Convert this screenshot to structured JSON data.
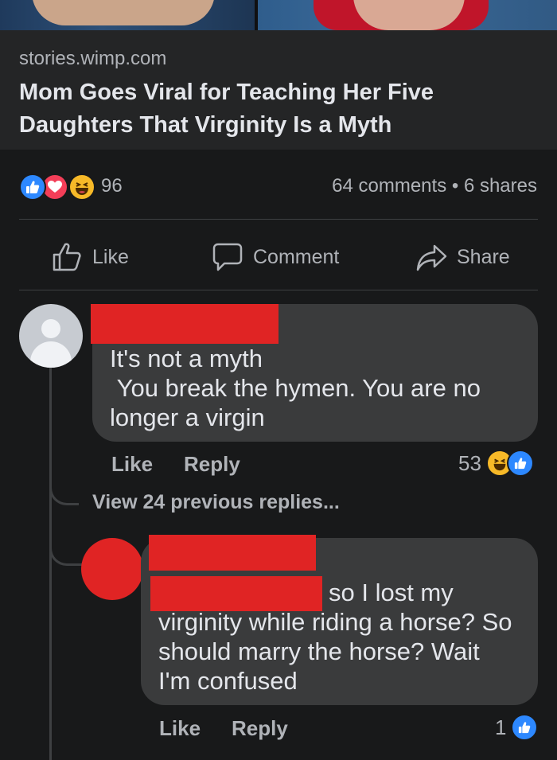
{
  "link_preview": {
    "domain": "stories.wimp.com",
    "title": "Mom Goes Viral for Teaching Her Five Daughters That Virginity Is a Myth"
  },
  "post_stats": {
    "reactions": [
      "like",
      "love",
      "haha"
    ],
    "reaction_count": "96",
    "comments_shares": "64 comments • 6 shares"
  },
  "post_actions": {
    "like": "Like",
    "comment": "Comment",
    "share": "Share"
  },
  "comments": [
    {
      "author": "",
      "text": "It's not a myth\n You break the hymen. You are no\nlonger a virgin",
      "like_label": "Like",
      "reply_label": "Reply",
      "reaction_count": "53",
      "reactions": [
        "haha",
        "like"
      ]
    }
  ],
  "view_previous": "View 24 previous replies...",
  "replies": [
    {
      "author": "",
      "text_line1": "so I lost my",
      "text_rest": "virginity while riding a horse? So\nshould marry the horse? Wait\nI'm confused",
      "like_label": "Like",
      "reply_label": "Reply",
      "reaction_count": "1",
      "reactions": [
        "like"
      ]
    }
  ],
  "colors": {
    "background": "#18191a",
    "card": "#242526",
    "bubble": "#3a3b3c",
    "secondary_text": "#b0b3b8",
    "like_blue": "#2d88ff",
    "love_red": "#f33e58",
    "haha_yellow": "#f7b928",
    "redaction": "#e02424"
  }
}
